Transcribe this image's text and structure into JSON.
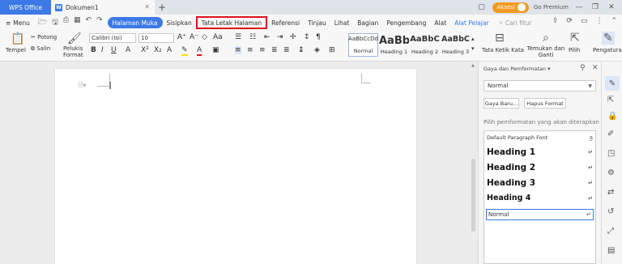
{
  "titlebar": {
    "app_tab": "WPS Office",
    "doc_tab": "Dokumen1",
    "aksesi": "Aksesi",
    "go_premium": "Go Premium"
  },
  "menu": {
    "menu_label": "Menu",
    "tabs": [
      "Halaman Muka",
      "Sisipkan",
      "Tata Letak Halaman",
      "Referensi",
      "Tinjau",
      "Lihat",
      "Bagian",
      "Pengembang",
      "Alat",
      "Alat Pelajar"
    ],
    "search_placeholder": "Cari fitur"
  },
  "ribbon": {
    "paste": "Tempel",
    "cut": "Potong",
    "copy": "Salin",
    "format_painter": "Pelukis Format",
    "font_name": "Calibri (Isi)",
    "font_size": "10",
    "styles": [
      {
        "preview": "AaBbCcDd",
        "label": "Normal"
      },
      {
        "preview": "AaBb",
        "label": "Heading 1"
      },
      {
        "preview": "AaBbC",
        "label": "Heading 2"
      },
      {
        "preview": "AaBbC",
        "label": "Heading 3"
      }
    ],
    "text_layout": "Tata Ketik Kata",
    "find_replace": "Temukan dan Ganti",
    "select": "Pilih",
    "settings": "Pengaturan"
  },
  "panel": {
    "title": "Gaya dan Pemformatan",
    "current_style": "Normal",
    "new_style_btn": "Gaya Baru...",
    "clear_format_btn": "Hapus Format",
    "pick_label": "Pilih pemformatan yang akan diterapkan",
    "style_list": [
      "Default Paragraph Font",
      "Heading 1",
      "Heading 2",
      "Heading 3",
      "Heading 4",
      "Normal"
    ]
  },
  "colors": {
    "accent": "#3c79e6",
    "highlight_box": "#e0141f",
    "premium": "#f39a21"
  }
}
